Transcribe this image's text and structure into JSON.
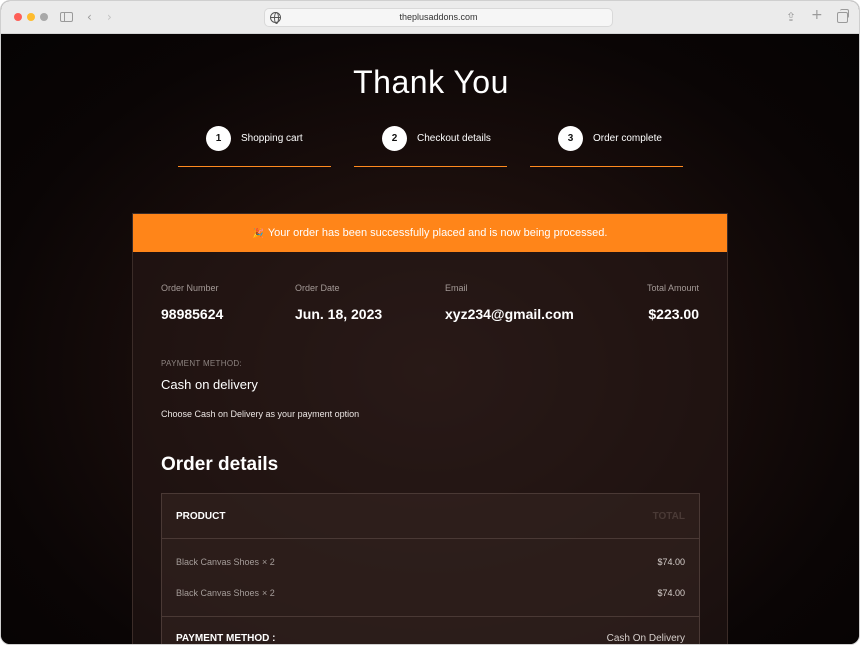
{
  "browser": {
    "url": "theplusaddons.com",
    "icons": [
      "sidebar-icon",
      "back-icon",
      "forward-icon",
      "globe-icon",
      "share-icon",
      "new-tab-icon",
      "tabs-overview-icon"
    ]
  },
  "page": {
    "title": "Thank You",
    "steps": [
      {
        "number": "1",
        "label": "Shopping cart"
      },
      {
        "number": "2",
        "label": "Checkout details"
      },
      {
        "number": "3",
        "label": "Order complete"
      }
    ],
    "accent_color": "#ff8519"
  },
  "order": {
    "banner": {
      "icon": "party-icon",
      "glyph": "🎉",
      "text": "Your order has been successfully placed and is now being processed."
    },
    "meta": {
      "order_number_label": "Order Number",
      "order_number": "98985624",
      "order_date_label": "Order Date",
      "order_date": "Jun. 18, 2023",
      "email_label": "Email",
      "email": "xyz234@gmail.com",
      "total_label": "Total Amount",
      "total": "$223.00"
    },
    "payment": {
      "label": "PAYMENT METHOD:",
      "value": "Cash on delivery",
      "note": "Choose Cash on Delivery as your payment option"
    },
    "details": {
      "title": "Order details",
      "header_product": "PRODUCT",
      "header_total": "TOTAL",
      "items": [
        {
          "name": "Black Canvas Shoes",
          "qty": "× 2",
          "price": "$74.00"
        },
        {
          "name": "Black Canvas Shoes",
          "qty": "× 2",
          "price": "$74.00"
        }
      ],
      "payment_method_label": "PAYMENT METHOD :",
      "payment_method_value": "Cash On Delivery"
    }
  }
}
